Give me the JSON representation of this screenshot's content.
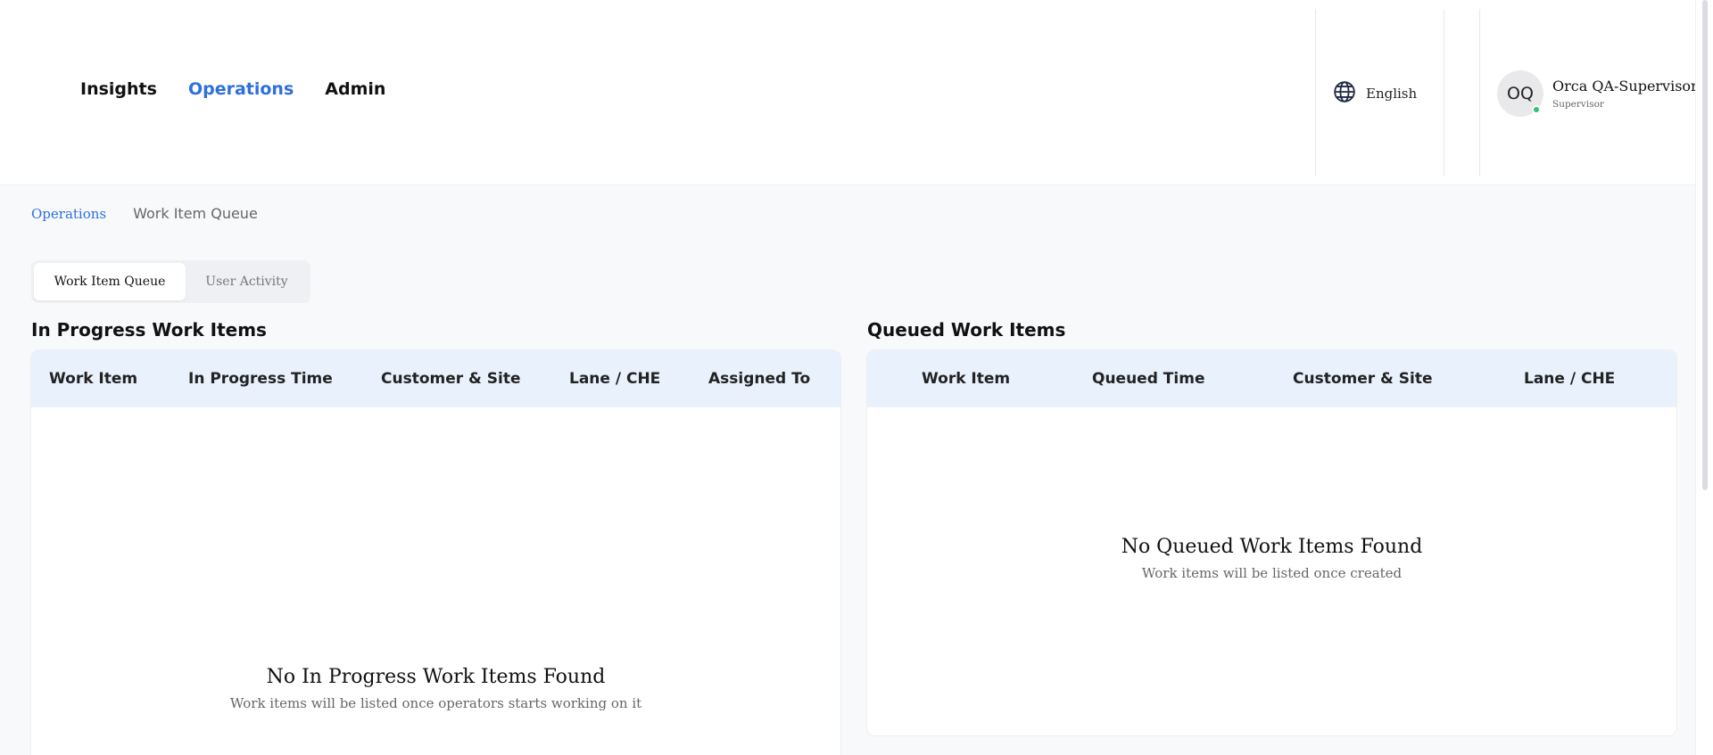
{
  "nav": {
    "items": [
      {
        "label": "Insights",
        "active": false
      },
      {
        "label": "Operations",
        "active": true
      },
      {
        "label": "Admin",
        "active": false
      }
    ]
  },
  "language": {
    "label": "English",
    "icon": "globe-icon"
  },
  "user": {
    "initials": "OQ",
    "name": "Orca QA-Supervisor",
    "role": "Supervisor",
    "status_color": "#2ec26b"
  },
  "breadcrumb": {
    "parent": "Operations",
    "current": "Work Item Queue"
  },
  "tabs": [
    {
      "label": "Work Item Queue",
      "active": true
    },
    {
      "label": "User Activity",
      "active": false
    }
  ],
  "in_progress": {
    "title": "In Progress Work Items",
    "columns": [
      "Work Item",
      "In Progress Time",
      "Customer & Site",
      "Lane / CHE",
      "Assigned To"
    ],
    "rows": [],
    "empty_title": "No In Progress Work Items Found",
    "empty_subtitle": "Work items will be listed once operators starts working on it"
  },
  "queued": {
    "title": "Queued Work Items",
    "columns": [
      "Work Item",
      "Queued Time",
      "Customer & Site",
      "Lane / CHE"
    ],
    "rows": [],
    "empty_title": "No Queued Work Items Found",
    "empty_subtitle": "Work items will be listed once created"
  },
  "colors": {
    "accent": "#2f6fde",
    "table_header_bg": "#e9f1fd",
    "page_bg": "#f8f9fb"
  }
}
